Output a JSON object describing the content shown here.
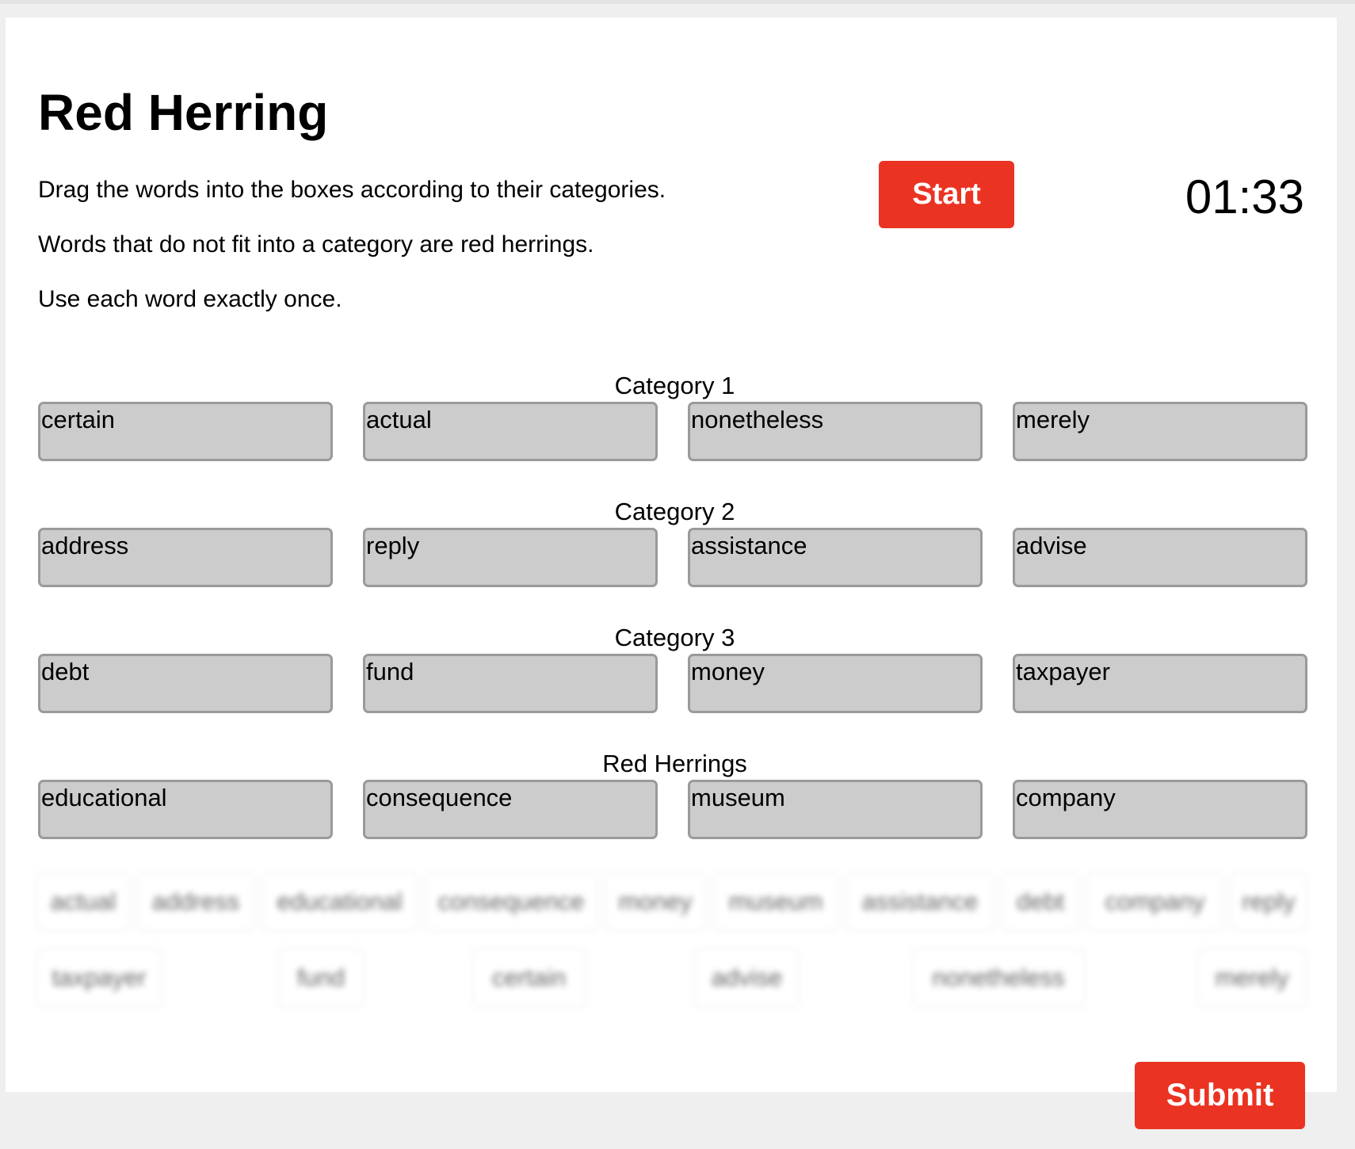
{
  "game": {
    "title": "Red Herring",
    "instructions": [
      "Drag the words into the boxes according to their categories.",
      "Words that do not fit into a category are red herrings.",
      "Use each word exactly once."
    ],
    "start_label": "Start",
    "timer": "01:33",
    "submit_label": "Submit",
    "accent_color": "#ea3322"
  },
  "categories": [
    {
      "label": "Category 1",
      "slots": [
        "certain",
        "actual",
        "nonetheless",
        "merely"
      ]
    },
    {
      "label": "Category 2",
      "slots": [
        "address",
        "reply",
        "assistance",
        "advise"
      ]
    },
    {
      "label": "Category 3",
      "slots": [
        "debt",
        "fund",
        "money",
        "taxpayer"
      ]
    },
    {
      "label": "Red Herrings",
      "slots": [
        "educational",
        "consequence",
        "museum",
        "company"
      ]
    }
  ],
  "word_bank": {
    "row1": [
      "actual",
      "address",
      "educational",
      "consequence",
      "money",
      "museum",
      "assistance",
      "debt",
      "company",
      "reply"
    ],
    "row2": [
      "taxpayer",
      "fund",
      "certain",
      "advise",
      "nonetheless",
      "merely"
    ]
  }
}
